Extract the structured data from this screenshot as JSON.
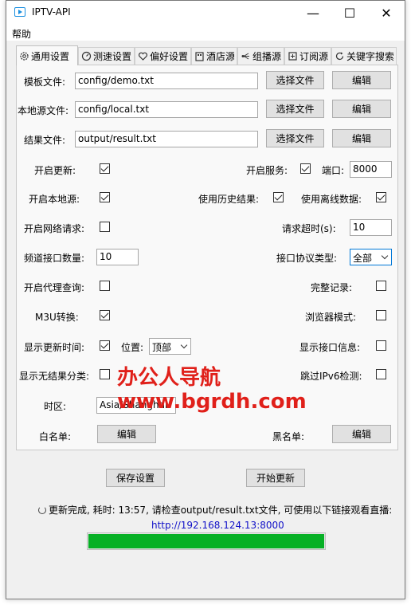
{
  "window": {
    "title": "IPTV-API",
    "minimize": "—",
    "maximize": "☐",
    "close": "✕"
  },
  "menu": {
    "help": "帮助"
  },
  "tabs": [
    {
      "label": "通用设置",
      "icon": "gear-icon"
    },
    {
      "label": "测速设置",
      "icon": "speedometer-icon"
    },
    {
      "label": "偏好设置",
      "icon": "heart-icon"
    },
    {
      "label": "酒店源",
      "icon": "hotel-icon"
    },
    {
      "label": "组播源",
      "icon": "multicast-icon"
    },
    {
      "label": "订阅源",
      "icon": "subscribe-icon"
    },
    {
      "label": "关键字搜索",
      "icon": "refresh-search-icon"
    }
  ],
  "files": {
    "template_label": "模板文件:",
    "template_value": "config/demo.txt",
    "local_label": "本地源文件:",
    "local_value": "config/local.txt",
    "result_label": "结果文件:",
    "result_value": "output/result.txt",
    "choose_label": "选择文件",
    "edit_label": "编辑"
  },
  "settings": {
    "open_update": {
      "label": "开启更新:",
      "checked": true
    },
    "open_service": {
      "label": "开启服务:",
      "checked": true
    },
    "port_label": "端口:",
    "port_value": "8000",
    "open_local": {
      "label": "开启本地源:",
      "checked": true
    },
    "use_history": {
      "label": "使用历史结果:",
      "checked": true
    },
    "use_offline": {
      "label": "使用离线数据:",
      "checked": true
    },
    "open_request": {
      "label": "开启网络请求:",
      "checked": false
    },
    "timeout_label": "请求超时(s):",
    "timeout_value": "10",
    "channel_count_label": "频道接口数量:",
    "channel_count_value": "10",
    "protocol_label": "接口协议类型:",
    "protocol_value": "全部",
    "open_proxy": {
      "label": "开启代理查询:",
      "checked": false
    },
    "full_record": {
      "label": "完整记录:",
      "checked": false
    },
    "m3u": {
      "label": "M3U转换:",
      "checked": true
    },
    "browser_mode": {
      "label": "浏览器模式:",
      "checked": false
    },
    "show_update_time": {
      "label": "显示更新时间:",
      "checked": true
    },
    "position_label": "位置:",
    "position_value": "顶部",
    "show_source_info": {
      "label": "显示接口信息:",
      "checked": false
    },
    "show_no_result": {
      "label": "显示无结果分类:",
      "checked": false
    },
    "skip_ipv6": {
      "label": "跳过IPv6检测:",
      "checked": false
    },
    "timezone_label": "时区:",
    "timezone_value": "Asia/Shanghai",
    "whitelist_label": "白名单:",
    "blacklist_label": "黑名单:"
  },
  "watermark": {
    "line1": "办公人导航",
    "line2": "www.bgrdh.com"
  },
  "actions": {
    "save": "保存设置",
    "start": "开始更新"
  },
  "status": {
    "message": "更新完成, 耗时: 13:57, 请检查output/result.txt文件, 可使用以下链接观看直播:",
    "url": "http://192.168.124.13:8000",
    "progress": 1.0
  },
  "colors": {
    "progress": "#06b025",
    "watermark": "#e0201a",
    "link": "#1010c8"
  }
}
